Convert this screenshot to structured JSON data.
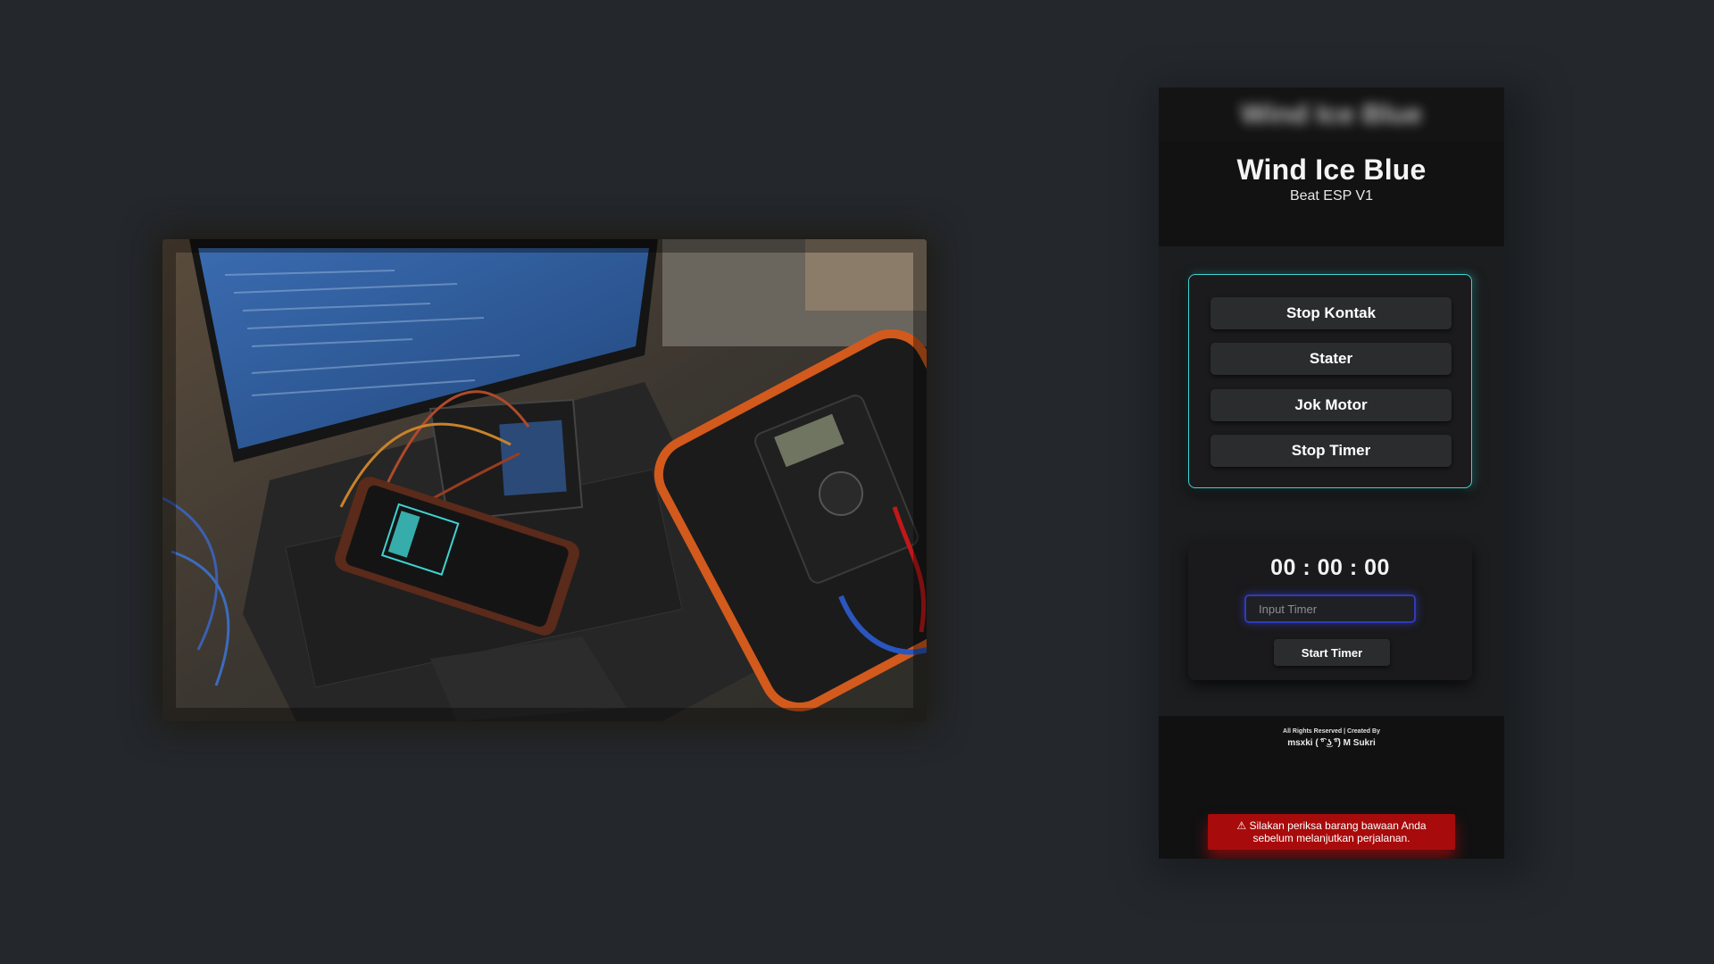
{
  "app": {
    "title": "Wind Ice Blue",
    "subtitle": "Beat ESP V1"
  },
  "controls": {
    "buttons": [
      {
        "label": "Stop Kontak"
      },
      {
        "label": "Stater"
      },
      {
        "label": "Jok Motor"
      },
      {
        "label": "Stop Timer"
      }
    ],
    "border_color": "#3fd3d0"
  },
  "timer": {
    "display": "00 : 00 : 00",
    "input_placeholder": "Input Timer",
    "start_label": "Start Timer",
    "input_border_color": "#2f3bb8"
  },
  "footer": {
    "rights": "All Rights Reserved | Created By",
    "author": "msxki ( ͡° ͜ʖ ͡°) M Sukri"
  },
  "warning": {
    "icon": "warning-icon",
    "text": "⚠ Silakan periksa barang bawaan Anda sebelum melanjutkan perjalanan.",
    "color": "#a80b0b"
  },
  "colors": {
    "page_background": "#24282d",
    "panel_background": "#1c1d1f"
  }
}
